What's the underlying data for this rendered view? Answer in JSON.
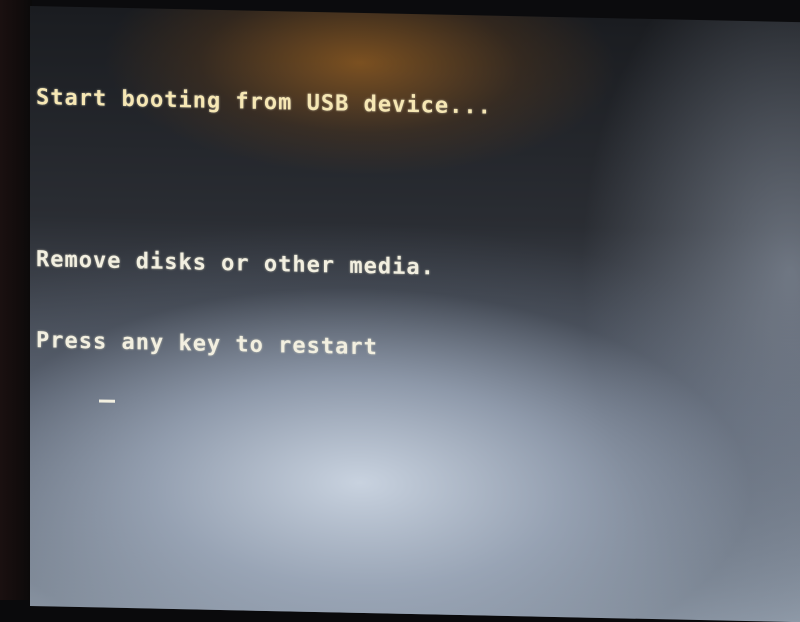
{
  "console": {
    "lines": [
      "Start booting from USB device...",
      "",
      "Remove disks or other media.",
      "Press any key to restart"
    ],
    "cursor": "_"
  },
  "colors": {
    "text": "#f2efe0",
    "background": "#1a1c20"
  }
}
